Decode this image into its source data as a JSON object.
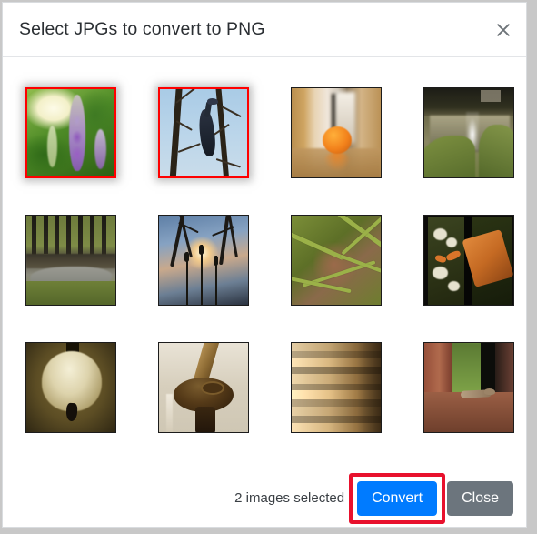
{
  "dialog": {
    "title": "Select JPGs to convert to PNG",
    "close_icon": "close-x-icon"
  },
  "footer": {
    "status_text": "2 images selected",
    "convert_label": "Convert",
    "close_label": "Close",
    "convert_color": "#007bff",
    "close_color": "#6c757d",
    "annotation_color": "#e8112d"
  },
  "grid": {
    "selected_count": 2,
    "selection_border_color": "#ff0000",
    "thumbnails": [
      {
        "name": "purple-flower-spike",
        "alt": "Purple flower spike on green bokeh background",
        "selected": true,
        "art": "art-flower"
      },
      {
        "name": "cormorant-in-tree",
        "alt": "Dark bird perched in bare tree against blue sky",
        "selected": true,
        "art": "art-bird"
      },
      {
        "name": "orange-on-table",
        "alt": "Orange fruit on reflective wooden table",
        "selected": false,
        "art": "art-orange"
      },
      {
        "name": "pond-fountain",
        "alt": "Water fountain in pond with grass banks",
        "selected": false,
        "art": "art-fountain"
      },
      {
        "name": "forest-pond",
        "alt": "Burnt forest trunks above a small pond",
        "selected": false,
        "art": "art-forest"
      },
      {
        "name": "sunset-through-trees",
        "alt": "Sunset glow through bare trees and reeds",
        "selected": false,
        "art": "art-sunset"
      },
      {
        "name": "green-reeds",
        "alt": "Green reed blades over reddish ground",
        "selected": false,
        "art": "art-grass"
      },
      {
        "name": "salmon-plate",
        "alt": "Plated salmon fillet with vegetables",
        "selected": false,
        "art": "art-food"
      },
      {
        "name": "pendant-lamp",
        "alt": "Glowing pendant lamp shade",
        "selected": false,
        "art": "art-lamp"
      },
      {
        "name": "banister-knob",
        "alt": "Wooden banister post and knob",
        "selected": false,
        "art": "art-rail"
      },
      {
        "name": "stacked-books",
        "alt": "Close-up of stacked book page edges",
        "selected": false,
        "art": "art-books"
      },
      {
        "name": "lizard-on-ledge",
        "alt": "Lizard on a brick ledge near grass",
        "selected": false,
        "art": "art-lizard"
      }
    ]
  }
}
